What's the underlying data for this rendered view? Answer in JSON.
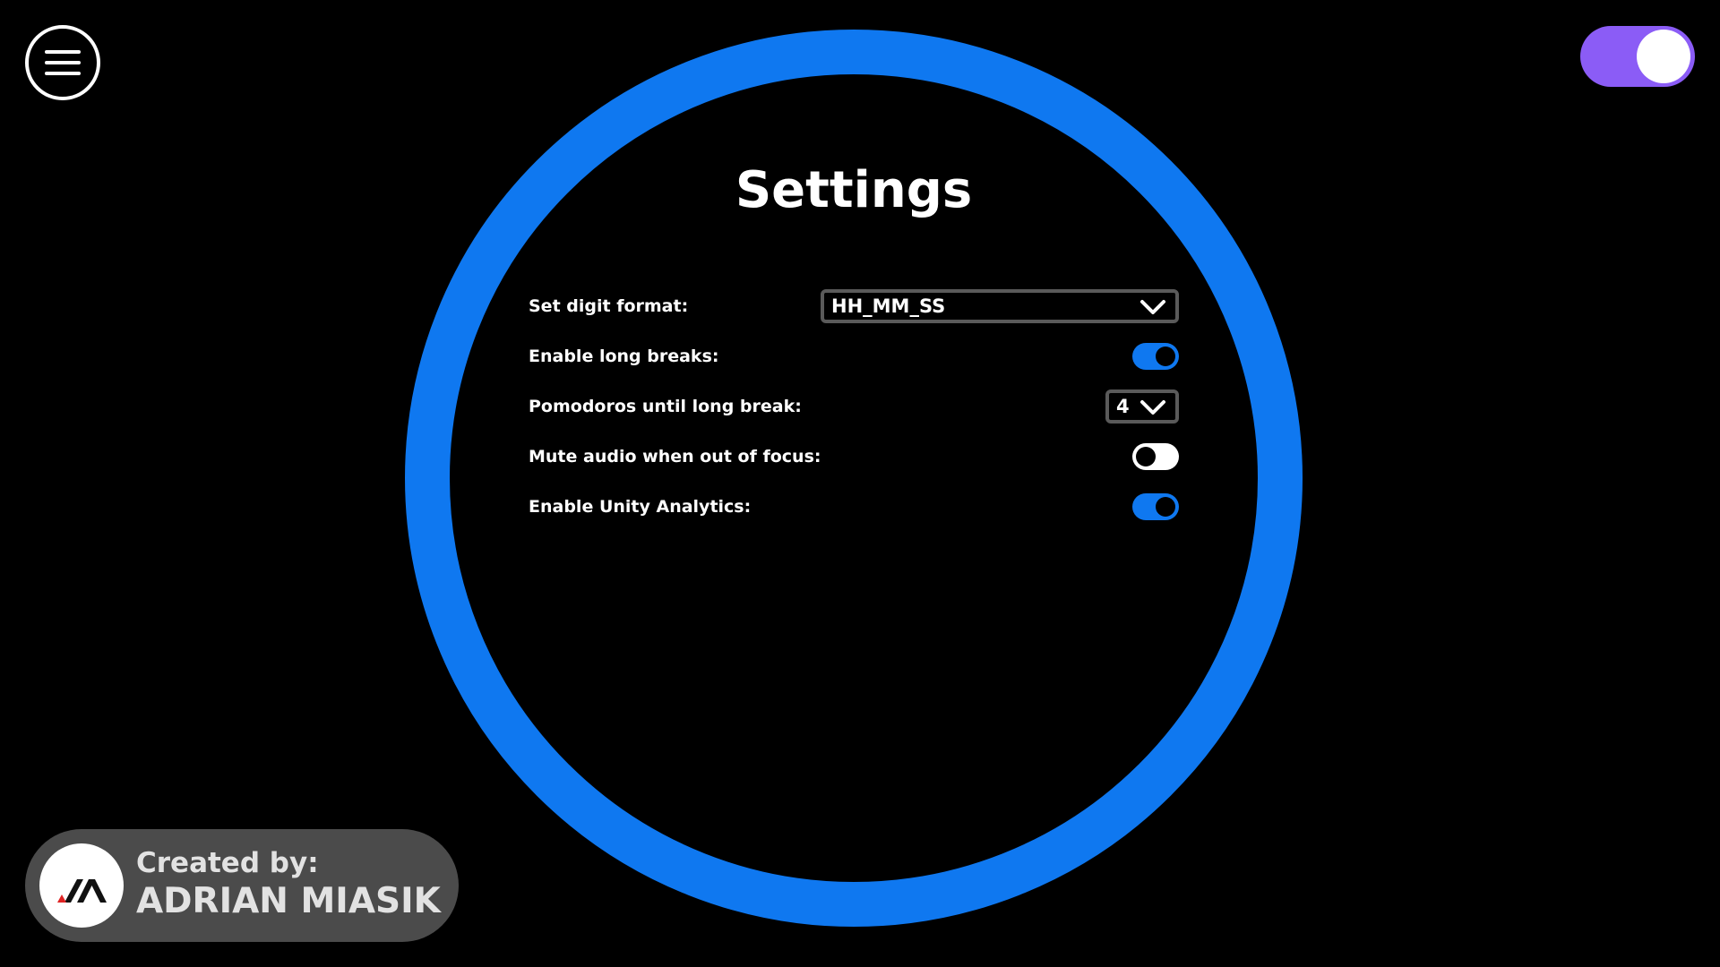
{
  "colors": {
    "background": "#000000",
    "ring": "#0f78f0",
    "accent_toggle": "#8b5cf6",
    "switch_on": "#0f78f0",
    "switch_off": "#ffffff",
    "badge": "#4b4b4b"
  },
  "header": {
    "menu_icon": "hamburger-menu-icon",
    "theme_toggle": {
      "state": "on"
    }
  },
  "settings": {
    "title": "Settings",
    "digit_format": {
      "label": "Set digit format:",
      "value": "HH_MM_SS",
      "icon": "chevron-down-icon"
    },
    "long_breaks": {
      "label": "Enable long breaks:",
      "state": "on"
    },
    "pomodoros_until_long_break": {
      "label": "Pomodoros until long break:",
      "value": "4",
      "icon": "chevron-down-icon"
    },
    "mute_audio": {
      "label": "Mute audio when out of focus:",
      "state": "off"
    },
    "unity_analytics": {
      "label": "Enable Unity Analytics:",
      "state": "on"
    }
  },
  "credit": {
    "logo_icon": "am-logo-icon",
    "line1": "Created by:",
    "line2": "ADRIAN MIASIK"
  }
}
